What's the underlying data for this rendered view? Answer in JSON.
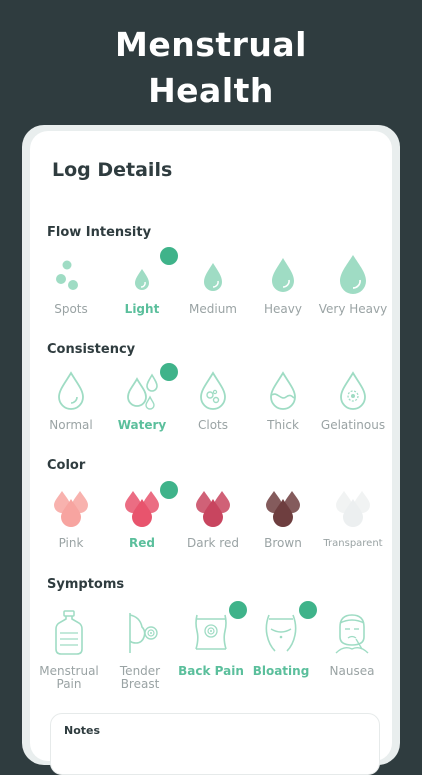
{
  "hero": {
    "line1": "Menstrual",
    "line2": "Health"
  },
  "card": {
    "title": "Log Details"
  },
  "flow": {
    "title": "Flow Intensity",
    "options": [
      {
        "label": "Spots"
      },
      {
        "label": "Light",
        "selected": true
      },
      {
        "label": "Medium"
      },
      {
        "label": "Heavy"
      },
      {
        "label": "Very Heavy"
      }
    ]
  },
  "consistency": {
    "title": "Consistency",
    "options": [
      {
        "label": "Normal"
      },
      {
        "label": "Watery",
        "selected": true
      },
      {
        "label": "Clots"
      },
      {
        "label": "Thick"
      },
      {
        "label": "Gelatinous"
      }
    ]
  },
  "color": {
    "title": "Color",
    "options": [
      {
        "label": "Pink",
        "hex": "#f7a4a0"
      },
      {
        "label": "Red",
        "hex": "#e8546d",
        "selected": true
      },
      {
        "label": "Dark red",
        "hex": "#c8455f"
      },
      {
        "label": "Brown",
        "hex": "#6e3e3f"
      },
      {
        "label": "Transparent",
        "hex": "#f1f3f3"
      }
    ]
  },
  "symptoms": {
    "title": "Symptoms",
    "options": [
      {
        "label_line1": "Menstrual",
        "label_line2": "Pain"
      },
      {
        "label_line1": "Tender",
        "label_line2": "Breast"
      },
      {
        "label_line1": "Back Pain",
        "selected": true
      },
      {
        "label_line1": "Bloating",
        "selected": true
      },
      {
        "label_line1": "Nausea"
      }
    ]
  },
  "notes": {
    "label": "Notes"
  },
  "colors": {
    "accent": "#5bbf9c",
    "check": "#3fb38a",
    "dark": "#2f3c3f",
    "muted": "#9aa3a4"
  }
}
